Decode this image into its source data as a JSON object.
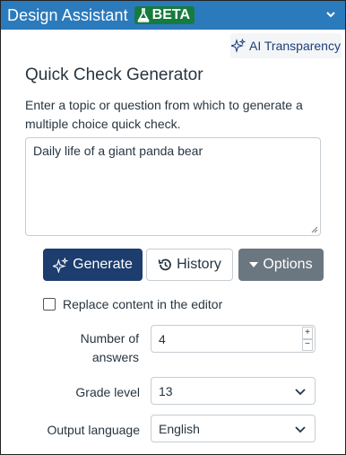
{
  "header": {
    "title": "Design Assistant",
    "badge": "BETA"
  },
  "ai_transparency": {
    "label": "AI Transparency"
  },
  "main": {
    "heading": "Quick Check Generator",
    "description": "Enter a topic or question from which to generate a multiple choice quick check.",
    "topic_value": "Daily life of a giant panda bear"
  },
  "buttons": {
    "generate": "Generate",
    "history": "History",
    "options": "Options"
  },
  "replace_checkbox": {
    "label": "Replace content in the editor",
    "checked": false
  },
  "settings": {
    "answers_label_line1": "Number of",
    "answers_label_line2": "answers",
    "answers_value": "4",
    "grade_label": "Grade level",
    "grade_value": "13",
    "language_label": "Output language",
    "language_value": "English"
  },
  "colors": {
    "header_bg": "#2b7abc",
    "badge_bg": "#167b3e",
    "generate_bg": "#1c3d6e",
    "options_bg": "#6b7780"
  }
}
